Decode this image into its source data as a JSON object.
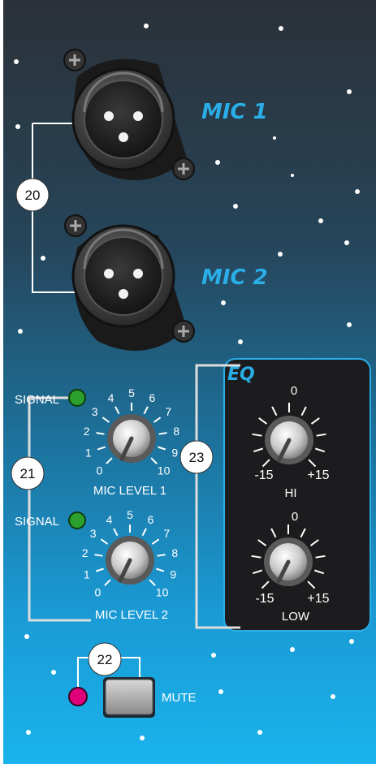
{
  "mic_inputs": [
    {
      "label": "MIC 1"
    },
    {
      "label": "MIC 2"
    }
  ],
  "callouts": [
    "20",
    "21",
    "22",
    "23"
  ],
  "channel_1": {
    "signal_label": "SIGNAL",
    "knob_label": "MIC LEVEL 1",
    "scale": [
      "0",
      "1",
      "2",
      "3",
      "4",
      "5",
      "6",
      "7",
      "8",
      "9",
      "10"
    ]
  },
  "channel_2": {
    "signal_label": "SIGNAL",
    "knob_label": "MIC LEVEL 2",
    "scale": [
      "0",
      "1",
      "2",
      "3",
      "4",
      "5",
      "6",
      "7",
      "8",
      "9",
      "10"
    ]
  },
  "eq": {
    "title": "EQ",
    "hi": {
      "label": "HI",
      "min": "-15",
      "center": "0",
      "max": "+15"
    },
    "low": {
      "label": "LOW",
      "min": "-15",
      "center": "0",
      "max": "+15"
    }
  },
  "mute": {
    "label": "MUTE"
  },
  "colors": {
    "panel_top": "#2b3138",
    "panel_bottom": "#1ab0e8",
    "accent_blue": "#2aaee8",
    "signal_led": "#2ca02c",
    "mute_led": "#e0007a"
  }
}
